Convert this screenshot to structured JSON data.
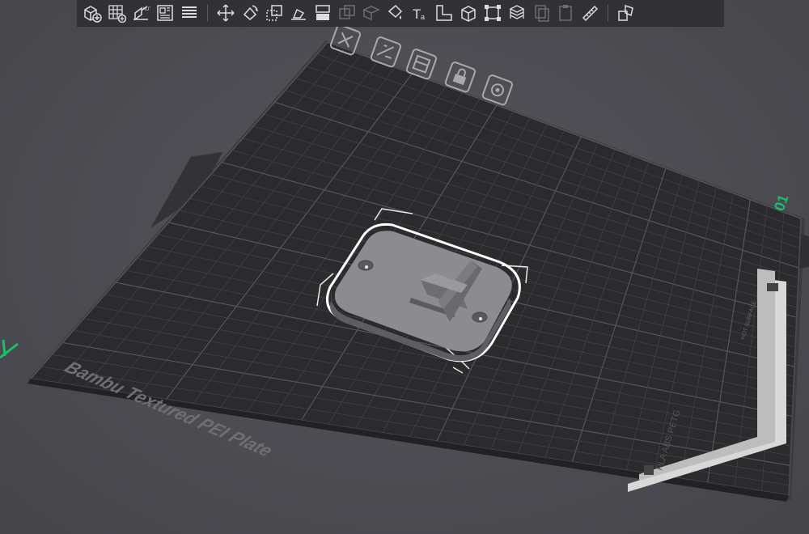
{
  "bed": {
    "plate_label": "Bambu Textured PEI Plate",
    "filament_label": "PLA ABS PETG",
    "plate_number": "01",
    "hot_label": "HOT SURFACE"
  },
  "axes": {
    "y_label": "y"
  },
  "toolbar": {
    "groups": [
      [
        "add-object-icon",
        "add-plate-icon",
        "auto-orient-icon",
        "arrange-icon",
        "split-layers-icon"
      ],
      [
        "move-icon",
        "rotate-icon",
        "scale-icon",
        "lay-on-face-icon",
        "cut-icon",
        "boolean-icon",
        "support-paint-icon",
        "color-paint-icon",
        "text-icon",
        "measure-icon",
        "assembly-icon",
        "fit-plate-icon",
        "variable-layer-icon",
        "copy-icon",
        "paste-icon",
        "ruler-icon"
      ],
      [
        "assembly-view-icon"
      ]
    ]
  },
  "colors": {
    "background": "#4a4a50",
    "plate": "#2b2b2e",
    "grid": "#45454a",
    "object": "#8a8a8e",
    "selection": "#ffffff",
    "axis_green": "#19c06a"
  }
}
